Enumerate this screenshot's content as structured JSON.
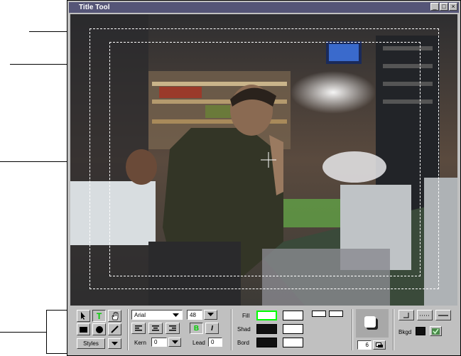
{
  "window": {
    "title": "Title Tool",
    "controls": {
      "minimize": "_",
      "maximize": "□",
      "close": "×"
    }
  },
  "toolbar": {
    "text_tool_glyph": "T",
    "styles_label": "Styles",
    "font_value": "Arial",
    "size_value": "48",
    "bold_label": "B",
    "italic_label": "I",
    "kern_label": "Kern",
    "kern_value": "0",
    "lead_label": "Lead",
    "lead_value": "0",
    "fill_label": "Fill",
    "shad_label": "Shad",
    "bord_label": "Bord",
    "shadow_value": "6",
    "bkgd_label": "Bkgd"
  },
  "colors": {
    "titlebar": "#555577",
    "panel": "#c0c0c0",
    "fill_swatch_border": "#00ff00",
    "text_tool_active": "#00cc00",
    "shad_swatch": "#101010",
    "bord_swatch": "#101010",
    "bkgd_swatch": "#101010"
  },
  "icons": {
    "arrow": "arrow-cursor-icon",
    "text": "text-tool-icon",
    "hand": "hand-tool-icon",
    "rect": "rectangle-tool-icon",
    "ellipse": "ellipse-tool-icon",
    "line": "line-tool-icon"
  }
}
